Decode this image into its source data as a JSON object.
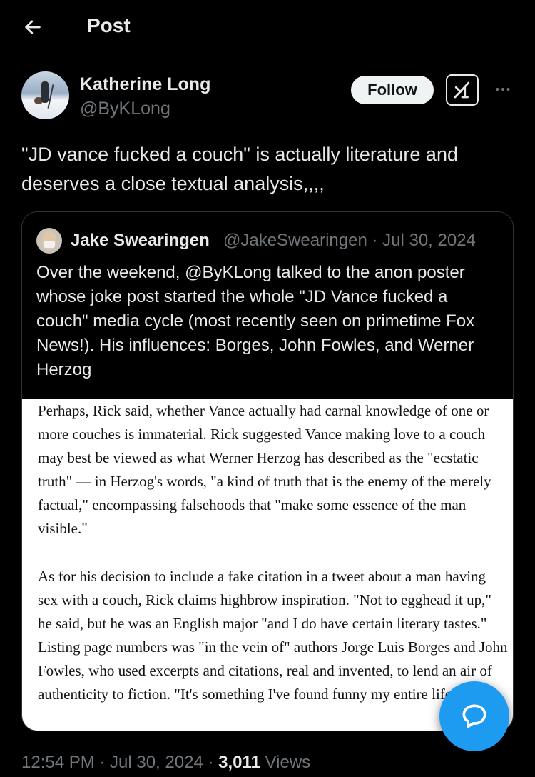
{
  "header": {
    "title": "Post"
  },
  "author": {
    "name": "Katherine Long",
    "handle": "@ByKLong",
    "follow_label": "Follow"
  },
  "post": {
    "text": "\"JD vance fucked a couch\" is actually literature and deserves a close textual analysis,,,,"
  },
  "quote": {
    "name": "Jake Swearingen",
    "meta": "@JakeSwearingen · Jul 30, 2024",
    "text": "Over the weekend, @ByKLong talked to the anon poster whose joke post started the whole \"JD Vance fucked a couch\" media cycle (most recently seen on primetime Fox News!). His influences: Borges, John Fowles, and Werner Herzog",
    "image_paragraph_1": "Perhaps, Rick said, whether Vance actually had carnal knowledge of one or more couches is immaterial. Rick suggested Vance making love to a couch may best be viewed as what Werner Herzog has described as the \"ecstatic truth\" — in Herzog's words, \"a kind of truth that is the enemy of the merely factual,\" encompassing falsehoods that \"make some essence of the man visible.\"",
    "image_paragraph_2": "As for his decision to include a fake citation in a tweet about a man having sex with a couch, Rick claims highbrow inspiration. \"Not to egghead it up,\" he said, but he was an English major \"and I do have certain literary tastes.\" Listing page numbers was \"in the vein of\" authors Jorge Luis Borges and John Fowles, who used excerpts and citations, real and invented, to lend an air of authenticity to fiction. \"It's something I've found funny my entire life,\" he s"
  },
  "footer": {
    "time_date": "12:54 PM · Jul 30, 2024 · ",
    "views_count": "3,011",
    "views_label": " Views"
  },
  "icons": {
    "back": "arrow-left-icon",
    "grok": "grok-icon",
    "more": "more-horizontal-icon",
    "fab": "chat-bubble-icon"
  },
  "colors": {
    "background": "#000000",
    "text": "#e7e9ea",
    "muted": "#71767b",
    "accent": "#1d9bf0",
    "border": "#2f3336"
  }
}
